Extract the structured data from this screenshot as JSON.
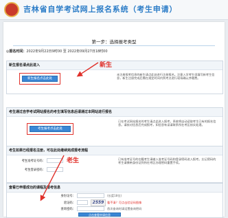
{
  "header": {
    "title": "吉林省自学考试网上报名系统（考生申请）"
  },
  "step": {
    "title": "第一步：选择报考类型",
    "time_label": "◎报名时间：",
    "time_value": "2022年9月22日9时00 至 2022年09月27日18时00"
  },
  "sections": [
    {
      "heading": "新生报名请点此进入",
      "button": "新生报名点击此处",
      "description": "未注册报考信息的新生请点此处进行注册报名。注意入学考生须填写新考生信息，新生注册完成后需在规定时间内到考点进行现场确认并缴费。",
      "annotation": "新生"
    },
    {
      "heading": "考生通过自学考试网站报名的考生填写信息后请通过本网站进行报名",
      "button": "考生报考点击此处",
      "description": "已在考试网站报名的考生请点此进入报考，系统将自动读取考生已有的报名信息。请核对信息后完成报考，如信息有误请联系所在考区核实处理。"
    },
    {
      "heading": "考生如果已经报名注册，可在此处继续完成报考流程",
      "label_exam_no": "考生准考证号码：",
      "label_password": "考生登录密码：",
      "annotation": "老生",
      "description": "已有准考证号的在籍考生请输入准考证号码和登录密码进入报考。忘记密码的考生请携带身份证到所在考区办理密码重置手续。"
    },
    {
      "heading": "查看已申报成功的课程及报考信息",
      "label_id": "身份证号：",
      "id_note": "(长度18位)",
      "label_code": "验证码：",
      "captcha": "2559",
      "captcha_note": "看不清？可点击验证码图像",
      "label_query": "查询密码：",
      "query_note": "首次查询时请设置查询密码",
      "button": "点击查看申请信息"
    }
  ],
  "colors": {
    "accent": "#3a87d5",
    "annotation": "#e0302a",
    "header_text": "#2b7cc7"
  }
}
